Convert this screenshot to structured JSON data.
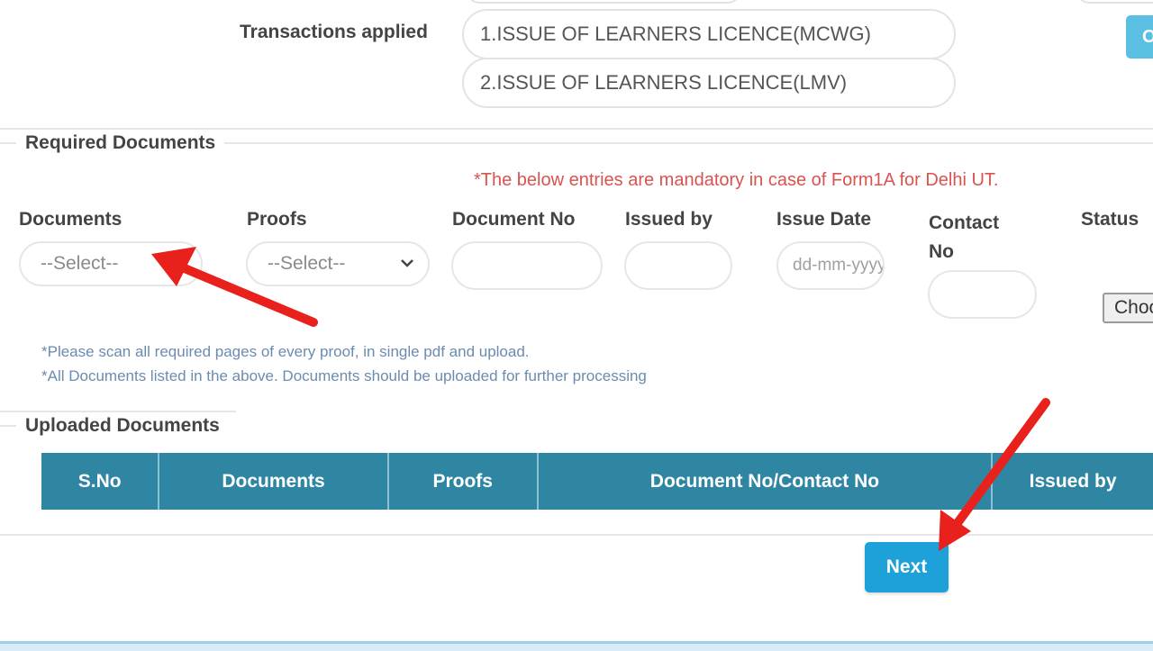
{
  "transactions": {
    "label": "Transactions applied",
    "items": [
      "1.ISSUE OF LEARNERS LICENCE(MCWG)",
      "2.ISSUE OF LEARNERS LICENCE(LMV)"
    ],
    "corner_button_label": "O"
  },
  "required_documents": {
    "legend": "Required Documents",
    "mandatory_note": "*The below entries are mandatory in case of Form1A for Delhi UT.",
    "columns": {
      "documents": "Documents",
      "proofs": "Proofs",
      "document_no": "Document No",
      "issued_by": "Issued by",
      "issue_date": "Issue Date",
      "contact_no": "Contact No",
      "status": "Status"
    },
    "documents_select": {
      "selected": "--Select--"
    },
    "proofs_select": {
      "selected": "--Select--"
    },
    "document_no_value": "",
    "issued_by_value": "",
    "issue_date_placeholder": "dd-mm-yyyy",
    "contact_no_value": "",
    "choose_file_label": "Choose File",
    "notes": [
      "*Please scan all required pages of every proof, in single pdf and upload.",
      "*All Documents listed in the above. Documents should be uploaded for further processing"
    ]
  },
  "uploaded_documents": {
    "legend": "Uploaded Documents",
    "headers": [
      "S.No",
      "Documents",
      "Proofs",
      "Document No/Contact No",
      "Issued by"
    ]
  },
  "next_button_label": "Next",
  "colors": {
    "table_header": "#2e86a3",
    "next_button": "#1ea0d9",
    "warning_text": "#d9534f",
    "annotation_arrow": "#e8211d"
  }
}
